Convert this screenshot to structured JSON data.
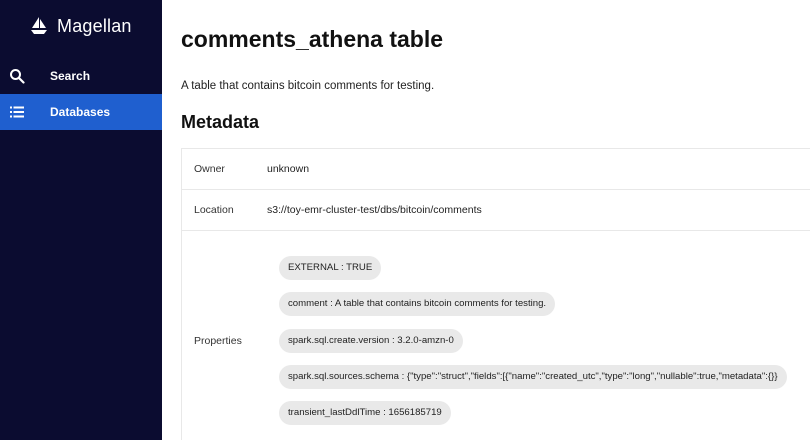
{
  "app": {
    "name": "Magellan"
  },
  "sidebar": {
    "items": [
      {
        "label": "Search",
        "icon": "search-icon"
      },
      {
        "label": "Databases",
        "icon": "list-icon",
        "active": true
      }
    ]
  },
  "page": {
    "title": "comments_athena table",
    "description": "A table that contains bitcoin comments for testing.",
    "metadata_heading": "Metadata"
  },
  "metadata": {
    "owner": {
      "key": "Owner",
      "value": "unknown"
    },
    "location": {
      "key": "Location",
      "value": "s3://toy-emr-cluster-test/dbs/bitcoin/comments"
    },
    "properties": {
      "key": "Properties",
      "items": [
        "EXTERNAL : TRUE",
        "comment : A table that contains bitcoin comments for testing.",
        "spark.sql.create.version : 3.2.0-amzn-0",
        "spark.sql.sources.schema : {\"type\":\"struct\",\"fields\":[{\"name\":\"created_utc\",\"type\":\"long\",\"nullable\":true,\"metadata\":{}}",
        "transient_lastDdlTime : 1656185719"
      ]
    }
  },
  "colors": {
    "sidebar_bg": "#0b0c30",
    "active_item_bg": "#1f5fcf",
    "chip_bg": "#e9e9e9"
  }
}
